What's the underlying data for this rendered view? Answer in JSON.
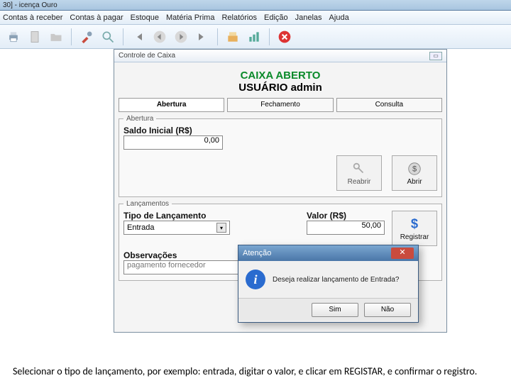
{
  "titlebar": "30] -  icença Ouro",
  "menu": {
    "m0": "Contas à receber",
    "m1": "Contas à pagar",
    "m2": "Estoque",
    "m3": "Matéria Prima",
    "m4": "Relatórios",
    "m5": "Edição",
    "m6": "Janelas",
    "m7": "Ajuda"
  },
  "panel": {
    "title": "Controle de Caixa",
    "status_open": "CAIXA ABERTO",
    "status_user": "USUÁRIO admin",
    "tabs": {
      "t0": "Abertura",
      "t1": "Fechamento",
      "t2": "Consulta"
    },
    "abertura": {
      "legend": "Abertura",
      "saldo_label": "Saldo Inicial (R$)",
      "saldo_value": "0,00",
      "reabrir": "Reabrir",
      "abrir": "Abrir"
    },
    "lanc": {
      "legend": "Lançamentos",
      "tipo_label": "Tipo de Lançamento",
      "tipo_value": "Entrada",
      "valor_label": "Valor (R$)",
      "valor_value": "50,00",
      "registrar": "Registrar",
      "obs_label": "Observações",
      "obs_value": "pagamento fornecedor"
    }
  },
  "dialog": {
    "title": "Atenção",
    "msg": "Deseja realizar lançamento de Entrada?",
    "yes": "Sim",
    "no": "Não"
  },
  "footer": "Selecionar o tipo de lançamento, por exemplo: entrada, digitar o valor, e clicar em REGISTAR, e confirmar o registro."
}
